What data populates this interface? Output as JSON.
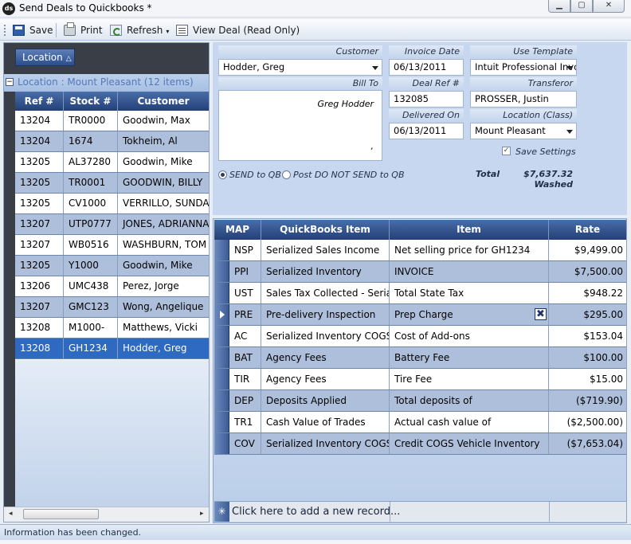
{
  "window": {
    "title": "Send Deals to Quickbooks *",
    "app_icon_text": "ds",
    "min_glyph": "▁",
    "max_glyph": "▢",
    "close_glyph": "✕"
  },
  "toolbar": {
    "save_label": "Save",
    "print_label": "Print",
    "refresh_label": "Refresh",
    "refresh_arrow": "▾",
    "view_deal_label": "View Deal (Read Only)"
  },
  "left": {
    "group_chip_label": "Location",
    "group_chip_sort": "△",
    "collapse_glyph": "−",
    "group_label": "Location : Mount Pleasant (12 items)",
    "columns": [
      "Ref #",
      "Stock #",
      "Customer"
    ],
    "rows": [
      {
        "ref": "13204",
        "stock": "TR0000",
        "customer": "Goodwin, Max"
      },
      {
        "ref": "13204",
        "stock": "1674",
        "customer": "Tokheim, Al"
      },
      {
        "ref": "13205",
        "stock": "AL37280",
        "customer": "Goodwin, Mike"
      },
      {
        "ref": "13205",
        "stock": "TR0001",
        "customer": "GOODWIN, BILLY"
      },
      {
        "ref": "13205",
        "stock": "CV1000",
        "customer": "VERRILLO, SUNDAY"
      },
      {
        "ref": "13207",
        "stock": "UTP0777",
        "customer": "JONES, ADRIANNA"
      },
      {
        "ref": "13207",
        "stock": "WB0516",
        "customer": "WASHBURN, TOM"
      },
      {
        "ref": "13205",
        "stock": "Y1000",
        "customer": "Goodwin, Mike"
      },
      {
        "ref": "13206",
        "stock": "UMC438",
        "customer": "Perez, Jorge"
      },
      {
        "ref": "13207",
        "stock": "GMC123",
        "customer": "Wong, Angelique"
      },
      {
        "ref": "13208",
        "stock": "M1000-",
        "customer": "Matthews, Vicki"
      },
      {
        "ref": "13208",
        "stock": "GH1234",
        "customer": "Hodder, Greg"
      }
    ],
    "scroll_left": "◂",
    "scroll_right": "▸"
  },
  "detail": {
    "customer_label": "Customer",
    "customer_value": "Hodder, Greg",
    "bill_to_label": "Bill To",
    "bill_to_value": "Greg Hodder",
    "bill_to_extra": ",",
    "invoice_date_label": "Invoice Date",
    "invoice_date_value": "06/13/2011",
    "deal_ref_label": "Deal Ref #",
    "deal_ref_value": "132085",
    "delivered_on_label": "Delivered On",
    "delivered_on_value": "06/13/2011",
    "use_template_label": "Use Template",
    "use_template_value": "Intuit Professional Invo",
    "transferor_label": "Transferor",
    "transferor_value": "PROSSER, Justin",
    "location_label": "Location (Class)",
    "location_value": "Mount Pleasant",
    "save_settings_label": "Save Settings",
    "save_settings_checked": true,
    "check_glyph": "✓",
    "send_label": "SEND to QB",
    "post_label": "Post DO NOT SEND to QB",
    "total_label": "Total",
    "total_value": "$7,637.32",
    "total_status": "Washed"
  },
  "items": {
    "columns": [
      "MAP",
      "QuickBooks Item",
      "Item",
      "Rate"
    ],
    "rows": [
      {
        "map": "NSP",
        "qb": "Serialized Sales Income",
        "item": "Net selling price for GH1234",
        "rate": "$9,499.00"
      },
      {
        "map": "PPI",
        "qb": "Serialized Inventory",
        "item": "INVOICE",
        "rate": "$7,500.00"
      },
      {
        "map": "UST",
        "qb": "Sales Tax Collected - Serial",
        "item": "Total State Tax",
        "rate": "$948.22"
      },
      {
        "map": "PRE",
        "qb": "Pre-delivery Inspection",
        "item": "Prep Charge",
        "rate": "$295.00"
      },
      {
        "map": "AC",
        "qb": "Serialized Inventory COGS",
        "item": "Cost of Add-ons",
        "rate": "$153.04"
      },
      {
        "map": "BAT",
        "qb": "Agency Fees",
        "item": "Battery Fee",
        "rate": "$100.00"
      },
      {
        "map": "TIR",
        "qb": "Agency Fees",
        "item": "Tire Fee",
        "rate": "$15.00"
      },
      {
        "map": "DEP",
        "qb": "Deposits Applied",
        "item": "Total deposits of",
        "rate": "($719.90)"
      },
      {
        "map": "TR1",
        "qb": "Cash Value of Trades",
        "item": "Actual cash value of",
        "rate": "($2,500.00)"
      },
      {
        "map": "COV",
        "qb": "Serialized Inventory COGS",
        "item": "Credit COGS Vehicle Inventory",
        "rate": "($7,653.04)"
      }
    ],
    "delete_glyph": "✖",
    "new_record_star": "✳",
    "new_record_text": "Click here to add a new record..."
  },
  "status": {
    "text": "Information has been changed."
  },
  "icons": {
    "app": "app-logo-icon",
    "save": "save-icon",
    "print": "print-icon",
    "refresh": "refresh-icon",
    "view": "view-deal-icon",
    "delete": "delete-row-icon"
  },
  "colors": {
    "header_bg": "#233f78",
    "row_alt": "#aebfdb",
    "row_selected": "#2e6ac2",
    "panel_bg": "#c7d7ef",
    "group_panel": "#3a3f47"
  }
}
